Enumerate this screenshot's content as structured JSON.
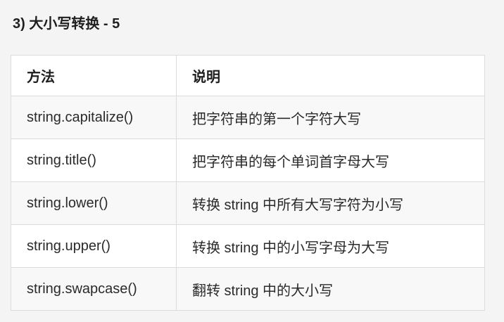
{
  "heading": "3) 大小写转换 - 5",
  "table": {
    "headers": [
      "方法",
      "说明"
    ],
    "rows": [
      {
        "method": "string.capitalize()",
        "description": "把字符串的第一个字符大写"
      },
      {
        "method": "string.title()",
        "description": "把字符串的每个单词首字母大写"
      },
      {
        "method": "string.lower()",
        "description": "转换 string 中所有大写字符为小写"
      },
      {
        "method": "string.upper()",
        "description": "转换 string 中的小写字母为大写"
      },
      {
        "method": "string.swapcase()",
        "description": "翻转 string 中的大小写"
      }
    ]
  },
  "colors": {
    "background": "#f4f4f4",
    "border": "#dcdcdc",
    "row_alt": "#f8f8f8"
  }
}
